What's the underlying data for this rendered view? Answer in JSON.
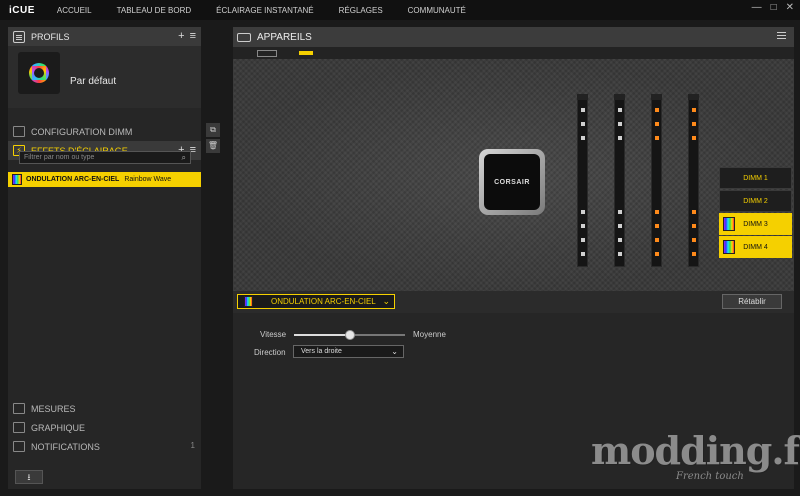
{
  "titlebar": {
    "logo": "iCUE",
    "nav": [
      "ACCUEIL",
      "TABLEAU DE BORD",
      "ÉCLAIRAGE INSTANTANÉ",
      "RÉGLAGES",
      "COMMUNAUTÉ"
    ],
    "controls": [
      "—",
      "□",
      "✕"
    ]
  },
  "profiles": {
    "header": "PROFILS",
    "add": "+",
    "menu": "≡",
    "profile_name": "Par défaut"
  },
  "sections": {
    "dimm_config": "CONFIGURATION DIMM",
    "lighting_effects": "EFFETS D'ÉCLAIRAGE",
    "measures": "MESURES",
    "graph": "GRAPHIQUE",
    "notifications": "NOTIFICATIONS",
    "notifications_count": "1"
  },
  "filter": {
    "placeholder": "Filtrer par nom ou type",
    "search_icon": "⌕"
  },
  "effect_list": [
    {
      "name": "ONDULATION ARC-EN-CIEL",
      "type": "Rainbow Wave"
    }
  ],
  "tools": {
    "copy": "⧉",
    "delete": "🗑"
  },
  "download_icon": "⭳",
  "devices": {
    "header": "APPAREILS",
    "cooler_brand": "CORSAIR",
    "dimms": [
      {
        "label": "DIMM 1",
        "active": false
      },
      {
        "label": "DIMM 2",
        "active": false
      },
      {
        "label": "DIMM 3",
        "active": true
      },
      {
        "label": "DIMM 4",
        "active": true
      }
    ]
  },
  "effect_bar": {
    "selected_effect": "ONDULATION ARC-EN-CIEL",
    "chevron": "⌄",
    "reset": "Rétablir"
  },
  "settings": {
    "speed_label": "Vitesse",
    "speed_value": "Moyenne",
    "speed_level": 0.5,
    "direction_label": "Direction",
    "direction_value": "Vers la droite"
  },
  "watermark": {
    "main": "modding.fr",
    "sub": "French touch"
  },
  "colors": {
    "accent": "#f5d000",
    "led_orange": "#ff8a1a",
    "background": "#1a1a1a"
  }
}
